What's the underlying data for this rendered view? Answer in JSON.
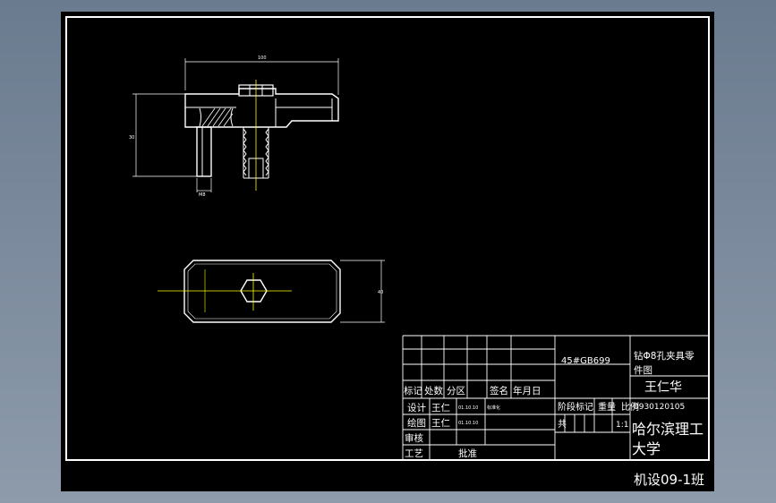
{
  "dimensions": {
    "front_length": "100",
    "front_height": "30",
    "pin_size": "M8",
    "plan_height": "40"
  },
  "title_block": {
    "material": "45#GB699",
    "part_title_line1": "钻Φ8孔夹具零",
    "part_title_line2": "件图",
    "designer_name": "王仁华",
    "student_id": "0930120105",
    "school_line1": "哈尔滨理工",
    "school_line2": "大学",
    "class_name": "机设09-1班",
    "hdr_mark": "标记",
    "hdr_count": "处数",
    "hdr_zone": "分区",
    "hdr_sign": "签名",
    "hdr_date": "年月日",
    "row_design": "设计",
    "row_design_name": "王仁",
    "row_design_date": "01.10.10",
    "row_design_std": "标准化",
    "row_draw": "绘图",
    "row_draw_name": "王仁",
    "row_draw_date": "01.10.10",
    "row_check": "审核",
    "row_process": "工艺",
    "row_approve": "批准",
    "stage_label": "阶段标记",
    "weight_label": "重量",
    "scale_label": "比例",
    "sheet_label": "共",
    "scale_value": "1:1"
  }
}
